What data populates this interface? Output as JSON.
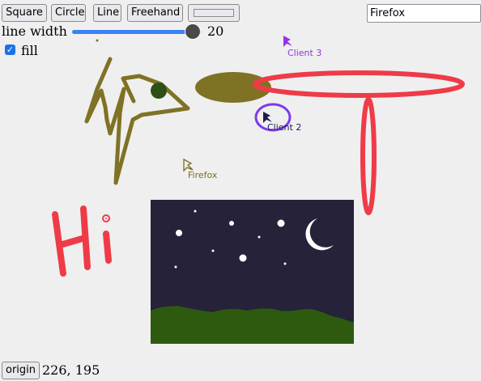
{
  "toolbar": {
    "square_label": "Square",
    "circle_label": "Circle",
    "line_label": "Line",
    "freehand_label": "Freehand",
    "color_button_color": "#efefef"
  },
  "name_input": {
    "value": "Firefox"
  },
  "line_width": {
    "label": "line width",
    "value": "20",
    "fraction": 0.93
  },
  "fill": {
    "label": "fill",
    "checked": true,
    "check_glyph": "✓"
  },
  "cursors": [
    {
      "name": "Client 3",
      "color": "#9333ea"
    },
    {
      "name": "Client 2",
      "color": "#1e1b4b"
    },
    {
      "name": "Firefox",
      "color": "#7c6e1e"
    }
  ],
  "drawing_colors": {
    "olive": "#7f7224",
    "red": "#ef3b48",
    "purple": "#7c3aed",
    "dark_green": "#2d5016",
    "night_sky": "#26223a",
    "hills": "#2e5a0f",
    "white": "#ffffff"
  },
  "handwritten_text": "Hi",
  "footer": {
    "origin_label": "origin",
    "coords": "226, 195"
  }
}
